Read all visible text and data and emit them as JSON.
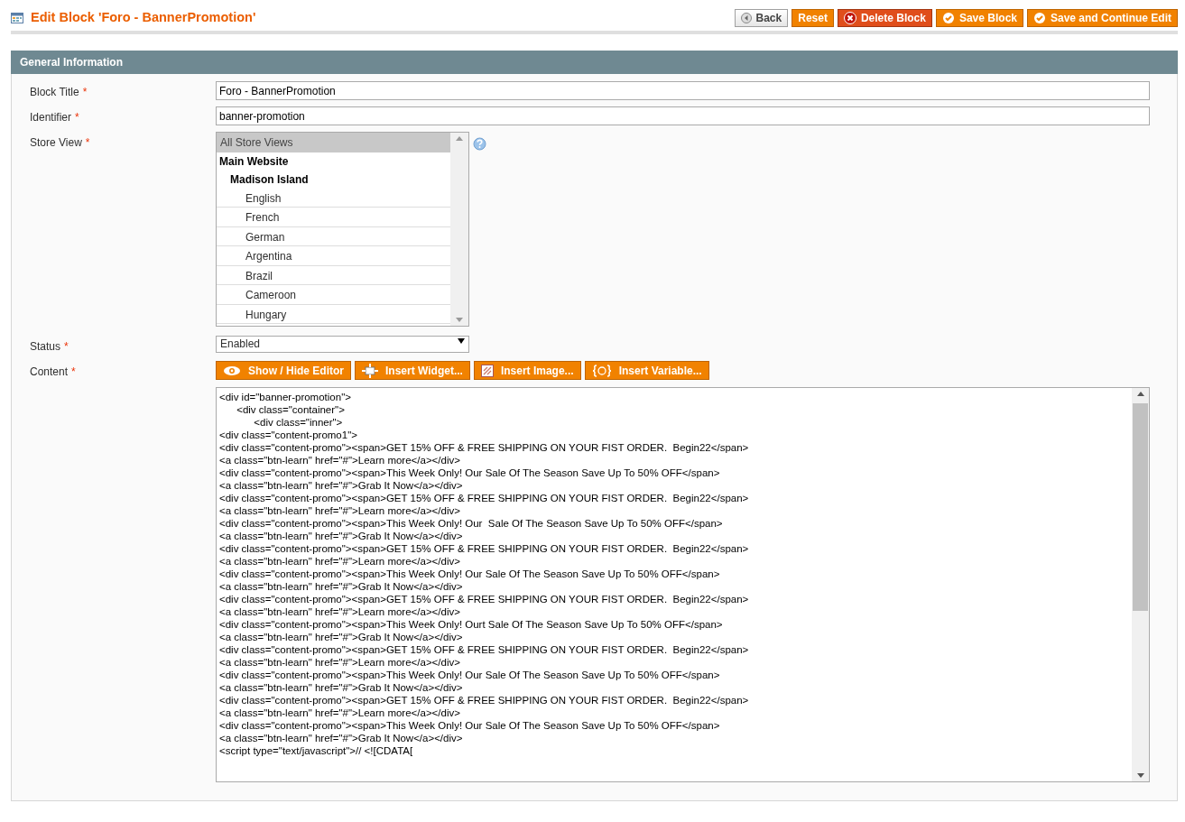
{
  "page_title": "Edit Block 'Foro - BannerPromotion'",
  "actions": [
    {
      "label": "Back",
      "kind": "back"
    },
    {
      "label": "Reset",
      "kind": "plain"
    },
    {
      "label": "Delete Block",
      "kind": "delete"
    },
    {
      "label": "Save Block",
      "kind": "save"
    },
    {
      "label": "Save and Continue Edit",
      "kind": "save"
    }
  ],
  "section": {
    "title": "General Information"
  },
  "fields": {
    "block_title": {
      "label": "Block Title",
      "required_mark": "*",
      "value": "Foro - BannerPromotion"
    },
    "identifier": {
      "label": "Identifier",
      "required_mark": "*",
      "value": "banner-promotion"
    },
    "store_view": {
      "label": "Store View",
      "required_mark": "*",
      "options": [
        {
          "label": "All Store Views",
          "kind": "option",
          "selected": true
        },
        {
          "label": "Main Website",
          "kind": "group",
          "children": [
            {
              "label": "Madison Island",
              "kind": "group",
              "children": [
                {
                  "label": "English",
                  "kind": "option",
                  "selected": false
                },
                {
                  "label": "French",
                  "kind": "option",
                  "selected": false
                },
                {
                  "label": "German",
                  "kind": "option",
                  "selected": false
                },
                {
                  "label": "Argentina",
                  "kind": "option",
                  "selected": false
                },
                {
                  "label": "Brazil",
                  "kind": "option",
                  "selected": false
                },
                {
                  "label": "Cameroon",
                  "kind": "option",
                  "selected": false
                },
                {
                  "label": "Hungary",
                  "kind": "option",
                  "selected": false
                }
              ]
            }
          ]
        }
      ]
    },
    "status": {
      "label": "Status",
      "required_mark": "*",
      "value": "Enabled"
    },
    "content": {
      "label": "Content",
      "required_mark": "*",
      "tools": [
        {
          "label": "Show / Hide Editor",
          "kind": "eye"
        },
        {
          "label": "Insert Widget...",
          "kind": "widget"
        },
        {
          "label": "Insert Image...",
          "kind": "image"
        },
        {
          "label": "Insert Variable...",
          "kind": "variable"
        }
      ],
      "lines": [
        "<div id=\"banner-promotion\">",
        "      <div class=\"container\">",
        "            <div class=\"inner\">",
        "<div class=\"content-promo1\">",
        "<div class=\"content-promo\"><span>GET 15% OFF & FREE SHIPPING ON YOUR FIST ORDER.  Begin22</span>",
        "<a class=\"btn-learn\" href=\"#\">Learn more</a></div>",
        "<div class=\"content-promo\"><span>This Week Only! Our Sale Of The Season Save Up To 50% OFF</span>",
        "<a class=\"btn-learn\" href=\"#\">Grab It Now</a></div>",
        "<div class=\"content-promo\"><span>GET 15% OFF & FREE SHIPPING ON YOUR FIST ORDER.  Begin22</span>",
        "<a class=\"btn-learn\" href=\"#\">Learn more</a></div>",
        "<div class=\"content-promo\"><span>This Week Only! Our  Sale Of The Season Save Up To 50% OFF</span>",
        "<a class=\"btn-learn\" href=\"#\">Grab It Now</a></div>",
        "<div class=\"content-promo\"><span>GET 15% OFF & FREE SHIPPING ON YOUR FIST ORDER.  Begin22</span>",
        "<a class=\"btn-learn\" href=\"#\">Learn more</a></div>",
        "<div class=\"content-promo\"><span>This Week Only! Our Sale Of The Season Save Up To 50% OFF</span>",
        "<a class=\"btn-learn\" href=\"#\">Grab It Now</a></div>",
        "<div class=\"content-promo\"><span>GET 15% OFF & FREE SHIPPING ON YOUR FIST ORDER.  Begin22</span>",
        "<a class=\"btn-learn\" href=\"#\">Learn more</a></div>",
        "<div class=\"content-promo\"><span>This Week Only! Ourt Sale Of The Season Save Up To 50% OFF</span>",
        "<a class=\"btn-learn\" href=\"#\">Grab It Now</a></div>",
        "<div class=\"content-promo\"><span>GET 15% OFF & FREE SHIPPING ON YOUR FIST ORDER.  Begin22</span>",
        "<a class=\"btn-learn\" href=\"#\">Learn more</a></div>",
        "<div class=\"content-promo\"><span>This Week Only! Our Sale Of The Season Save Up To 50% OFF</span>",
        "<a class=\"btn-learn\" href=\"#\">Grab It Now</a></div>",
        "<div class=\"content-promo\"><span>GET 15% OFF & FREE SHIPPING ON YOUR FIST ORDER.  Begin22</span>",
        "<a class=\"btn-learn\" href=\"#\">Learn more</a></div>",
        "<div class=\"content-promo\"><span>This Week Only! Our Sale Of The Season Save Up To 50% OFF</span>",
        "<a class=\"btn-learn\" href=\"#\">Grab It Now</a></div>",
        "<script type=\"text/javascript\">// <![CDATA["
      ]
    }
  }
}
